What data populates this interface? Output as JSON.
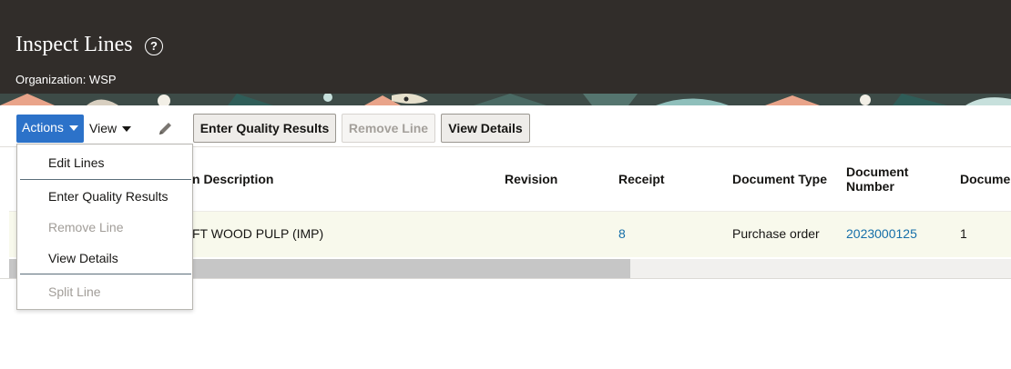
{
  "header": {
    "title": "Inspect Lines",
    "help_glyph": "?",
    "organization": "Organization: WSP"
  },
  "toolbar": {
    "actions_label": "Actions",
    "view_label": "View",
    "enter_quality_results": "Enter Quality Results",
    "remove_line": "Remove Line",
    "view_details": "View Details"
  },
  "table": {
    "columns": {
      "item_description": "n Description",
      "revision": "Revision",
      "receipt": "Receipt",
      "document_type": "Document Type",
      "document_number_1": "Document",
      "document_number_2": "Number",
      "document_line": "Docume"
    },
    "rows": [
      {
        "item_description": "FT WOOD PULP (IMP)",
        "revision": "",
        "receipt": "8",
        "document_type": "Purchase order",
        "document_number": "2023000125",
        "document_line": "1"
      }
    ]
  },
  "actions_menu": {
    "edit_lines": "Edit Lines",
    "enter_quality_results": "Enter Quality Results",
    "remove_line": "Remove Line",
    "view_details": "View Details",
    "split_line": "Split Line"
  },
  "colors": {
    "header_bg": "#312d2a",
    "accent": "#2c72c9",
    "link": "#166fa9",
    "row_highlight": "#f8f9ec"
  }
}
